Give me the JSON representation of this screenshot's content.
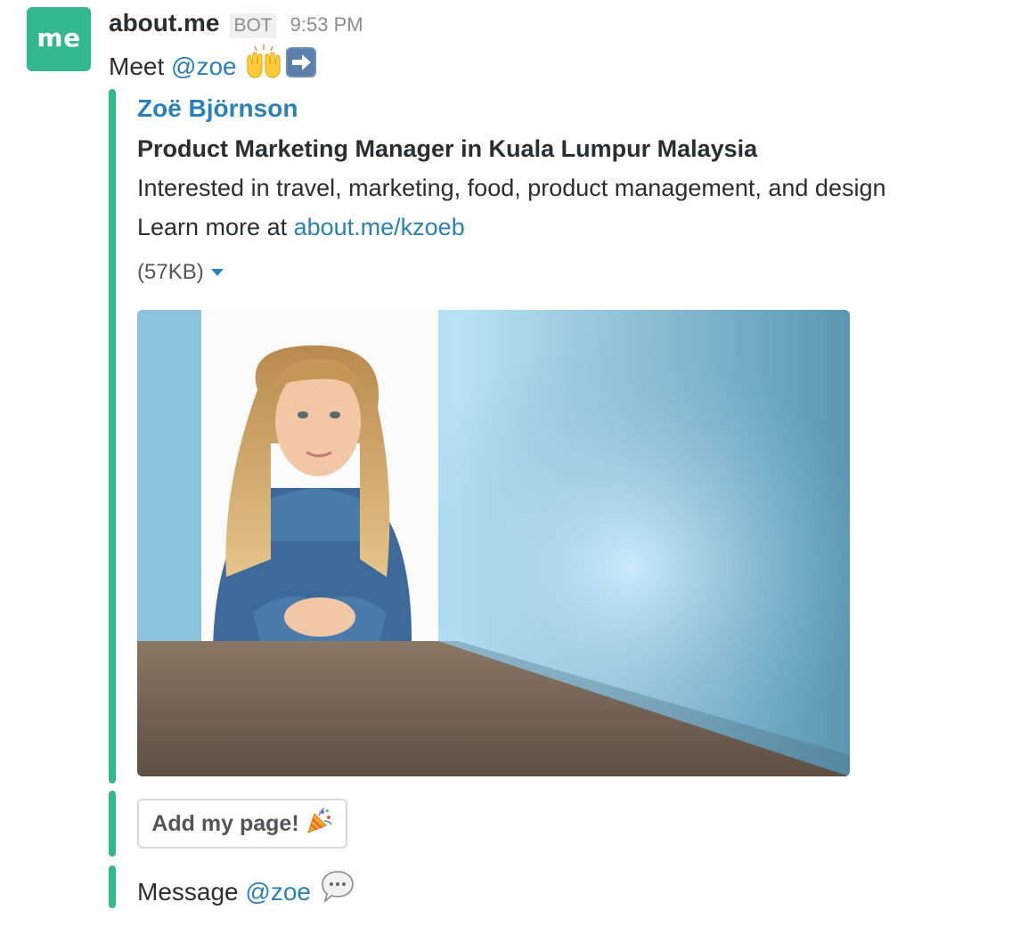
{
  "sender": {
    "avatar_text": "me",
    "name": "about.me",
    "badge": "BOT",
    "time": "9:53 PM"
  },
  "message": {
    "prefix": "Meet ",
    "mention": "@zoe",
    "emojis": [
      "raising-hands-icon",
      "right-arrow-icon"
    ]
  },
  "attachment": {
    "accent_color": "#32b88c",
    "title": "Zoë Björnson",
    "subtitle": "Product Marketing Manager in Kuala Lumpur Malaysia",
    "interests": "Interested in travel, marketing, food, product management, and design",
    "learn_more_prefix": "Learn more at ",
    "learn_more_link": "about.me/kzoeb",
    "file_size": "(57KB)"
  },
  "action_button": {
    "label": "Add my page!",
    "icon": "party-popper-icon"
  },
  "footer": {
    "prefix": "Message ",
    "mention": "@zoe",
    "icon": "speech-bubble-icon"
  },
  "colors": {
    "link": "#2a80b9",
    "avatar_bg": "#32b88c",
    "text": "#2c2d30",
    "muted": "#8d8d90"
  }
}
